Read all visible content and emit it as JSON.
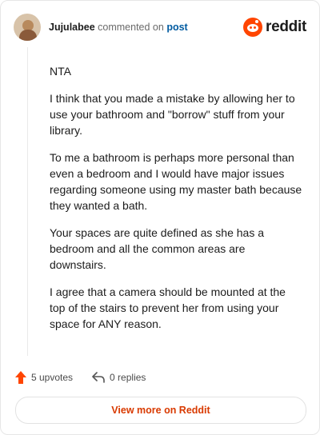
{
  "header": {
    "username": "Jujulabee",
    "action_text": "commented on",
    "post_link": "post",
    "brand_text": "reddit"
  },
  "comment": {
    "paragraphs": [
      "NTA",
      "I think that you made a mistake by allowing her to use your bathroom and \"borrow\" stuff from your library.",
      "To me a bathroom is perhaps more personal than even a bedroom and I would have major issues regarding someone using my master bath because they wanted a bath.",
      "Your spaces are quite defined as she has a bedroom and all the common areas are downstairs.",
      "I agree that a camera should be mounted at the top of the stairs to prevent her from using your space for ANY reason."
    ]
  },
  "actions": {
    "upvotes_label": "5 upvotes",
    "replies_label": "0 replies"
  },
  "footer": {
    "view_more_label": "View more on Reddit"
  },
  "colors": {
    "brand_orange": "#ff4500",
    "link_blue": "#005ba1",
    "cta_orange": "#d93a00"
  },
  "icons": {
    "upvote": "upvote-arrow-icon",
    "reply": "reply-arrow-icon",
    "brand": "reddit-logo-icon"
  }
}
